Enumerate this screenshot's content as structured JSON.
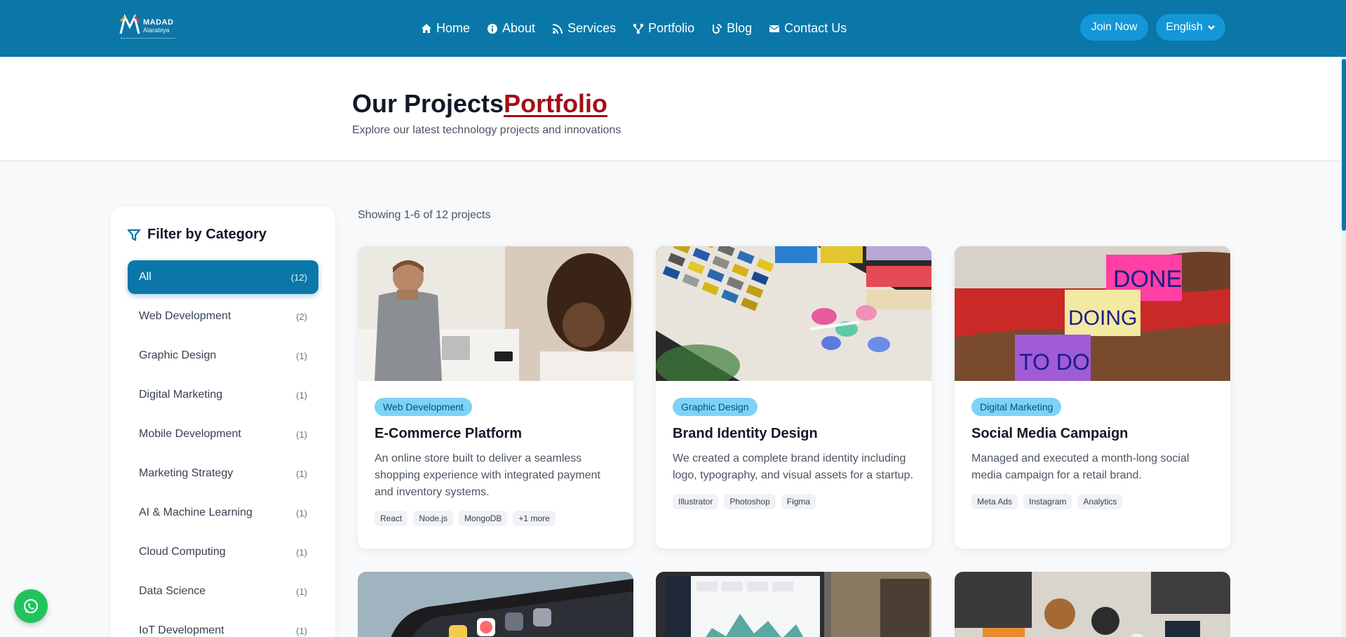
{
  "brand": {
    "name": "MADAD",
    "sub": "Alarabiya"
  },
  "nav": {
    "items": [
      {
        "label": "Home",
        "icon": "home-icon"
      },
      {
        "label": "About",
        "icon": "info-icon"
      },
      {
        "label": "Services",
        "icon": "rss-icon"
      },
      {
        "label": "Portfolio",
        "icon": "network-icon"
      },
      {
        "label": "Blog",
        "icon": "blog-icon"
      },
      {
        "label": "Contact Us",
        "icon": "envelope-icon"
      }
    ],
    "join_label": "Join Now",
    "language_label": "English"
  },
  "header": {
    "title_main": "Our Projects",
    "title_accent": "Portfolio",
    "subtitle": "Explore our latest technology projects and innovations"
  },
  "sidebar": {
    "title": "Filter by Category",
    "categories": [
      {
        "label": "All",
        "count": "(12)",
        "active": true
      },
      {
        "label": "Web Development",
        "count": "(2)"
      },
      {
        "label": "Graphic Design",
        "count": "(1)"
      },
      {
        "label": "Digital Marketing",
        "count": "(1)"
      },
      {
        "label": "Mobile Development",
        "count": "(1)"
      },
      {
        "label": "Marketing Strategy",
        "count": "(1)"
      },
      {
        "label": "AI & Machine Learning",
        "count": "(1)"
      },
      {
        "label": "Cloud Computing",
        "count": "(1)"
      },
      {
        "label": "Data Science",
        "count": "(1)"
      },
      {
        "label": "IoT Development",
        "count": "(1)"
      }
    ]
  },
  "main": {
    "showing": "Showing 1-6 of 12 projects",
    "projects": [
      {
        "category": "Web Development",
        "title": "E-Commerce Platform",
        "description": "An online store built to deliver a seamless shopping experience with integrated payment and inventory systems.",
        "tags": [
          "React",
          "Node.js",
          "MongoDB",
          "+1 more"
        ]
      },
      {
        "category": "Graphic Design",
        "title": "Brand Identity Design",
        "description": "We created a complete brand identity including logo, typography, and visual assets for a startup.",
        "tags": [
          "Illustrator",
          "Photoshop",
          "Figma"
        ]
      },
      {
        "category": "Digital Marketing",
        "title": "Social Media Campaign",
        "description": "Managed and executed a month-long social media campaign for a retail brand.",
        "tags": [
          "Meta Ads",
          "Instagram",
          "Analytics"
        ]
      }
    ],
    "sticky_notes": [
      "DONE",
      "DOING",
      "TO DO"
    ]
  },
  "colors": {
    "primary": "#0b77a8",
    "accent": "#a50d16",
    "badge": "#7dd3f5",
    "whatsapp": "#22c35e"
  }
}
